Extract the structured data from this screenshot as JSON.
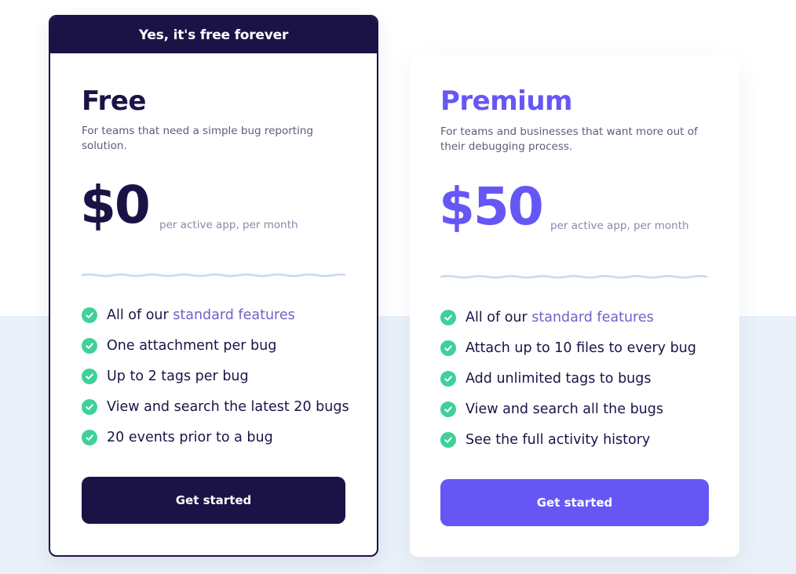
{
  "free_plan": {
    "banner": "Yes, it's free forever",
    "title": "Free",
    "description": "For teams that need a simple bug reporting solution.",
    "price": "$0",
    "price_unit": "per active app, per month",
    "features": [
      {
        "prefix": "All of our ",
        "link": "standard features"
      },
      {
        "text": "One attachment per bug"
      },
      {
        "text": "Up to 2 tags per bug"
      },
      {
        "text": "View and search the latest 20 bugs"
      },
      {
        "text": "20 events prior to a bug"
      }
    ],
    "cta": "Get started",
    "accent": "#1b1346"
  },
  "premium_plan": {
    "title": "Premium",
    "description": "For teams and businesses that want more out of their debugging process.",
    "price": "$50",
    "price_unit": "per active app, per month",
    "features": [
      {
        "prefix": "All of our ",
        "link": "standard features"
      },
      {
        "text": "Attach up to 10 files to every bug"
      },
      {
        "text": "Add unlimited tags to bugs"
      },
      {
        "text": "View and search all the bugs"
      },
      {
        "text": "See the full activity history"
      }
    ],
    "cta": "Get started",
    "accent": "#6657f5"
  },
  "colors": {
    "check": "#3ed19a",
    "link": "#6c63c7",
    "lower_background": "#e9f0f8"
  },
  "icons": {
    "feature_bullet": "check-circle-icon"
  }
}
